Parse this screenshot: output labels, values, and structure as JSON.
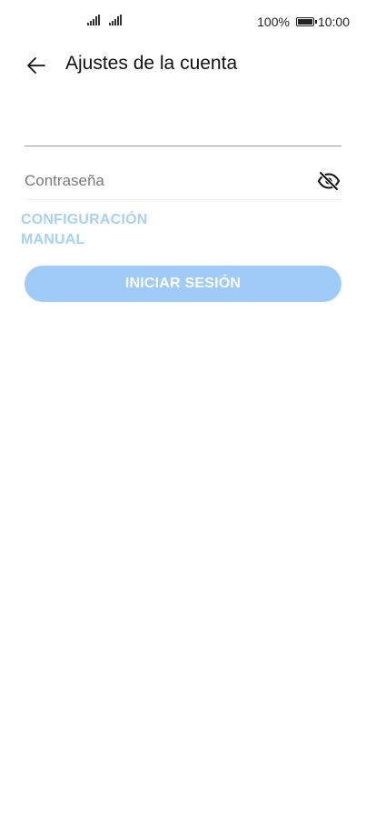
{
  "status_bar": {
    "battery_percent": "100%",
    "time": "10:00"
  },
  "header": {
    "title": "Ajustes de la cuenta",
    "back_icon": "arrow-left-icon"
  },
  "form": {
    "email_value": "",
    "password_placeholder": "Contraseña",
    "password_toggle_icon": "eye-off-icon",
    "manual_link": "CONFIGURACIÓN MANUAL",
    "login_button": "INICIAR SESIÓN"
  },
  "colors": {
    "link": "#a5d2f5",
    "button_bg": "#9ecbf7",
    "button_text": "#ffffff"
  }
}
